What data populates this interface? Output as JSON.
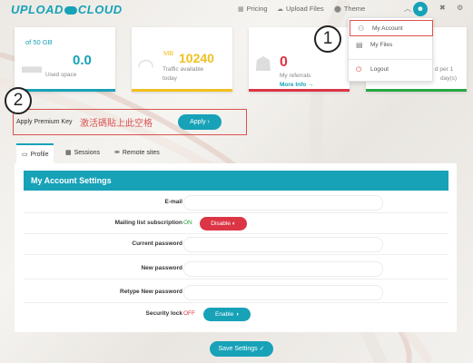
{
  "brand": {
    "logo_text_left": "UPLOAD",
    "logo_text_right": "CLOUD",
    "accent": "#17a2b8"
  },
  "topnav": {
    "pricing": "Pricing",
    "upload_files": "Upload Files",
    "theme": "Theme"
  },
  "user_menu": {
    "items": [
      {
        "label": "My Account",
        "icon": "user-cog-icon"
      },
      {
        "label": "My Files",
        "icon": "files-icon"
      },
      {
        "label": "Logout",
        "icon": "power-icon"
      }
    ]
  },
  "stats": {
    "storage": {
      "caption": "of 50 GB",
      "value": "0.0",
      "sub": "Used space"
    },
    "traffic": {
      "unit": "MB",
      "value": "10240",
      "sub1": "Traffic available",
      "sub2": "today"
    },
    "referrals": {
      "value": "0",
      "sub": "My referrals",
      "link": "More Info"
    },
    "downloads": {
      "sub1": "d per 1",
      "sub2": "day(s)"
    }
  },
  "premium": {
    "label": "Apply Premium Key",
    "input_value": "激活碼貼上此空格",
    "apply_label": "Apply"
  },
  "tabs": [
    {
      "label": "Profile",
      "icon": "id-card-icon"
    },
    {
      "label": "Sessions",
      "icon": "table-icon"
    },
    {
      "label": "Remote sites",
      "icon": "sitemap-icon"
    }
  ],
  "settings": {
    "title": "My Account Settings",
    "email_label": "E-mail",
    "mailing_label": "Mailing list subscription",
    "mailing_state": "ON",
    "mailing_button": "Disable",
    "current_password_label": "Current password",
    "new_password_label": "New password",
    "retype_password_label": "Retype New password",
    "security_label": "Security lock",
    "security_state": "OFF",
    "security_button": "Enable",
    "save_label": "Save Settings"
  },
  "annotations": {
    "one": "1",
    "two": "2"
  },
  "colors": {
    "accent": "#17a2b8",
    "danger": "#dc3545",
    "warning": "#f0c020",
    "success": "#28a745"
  }
}
